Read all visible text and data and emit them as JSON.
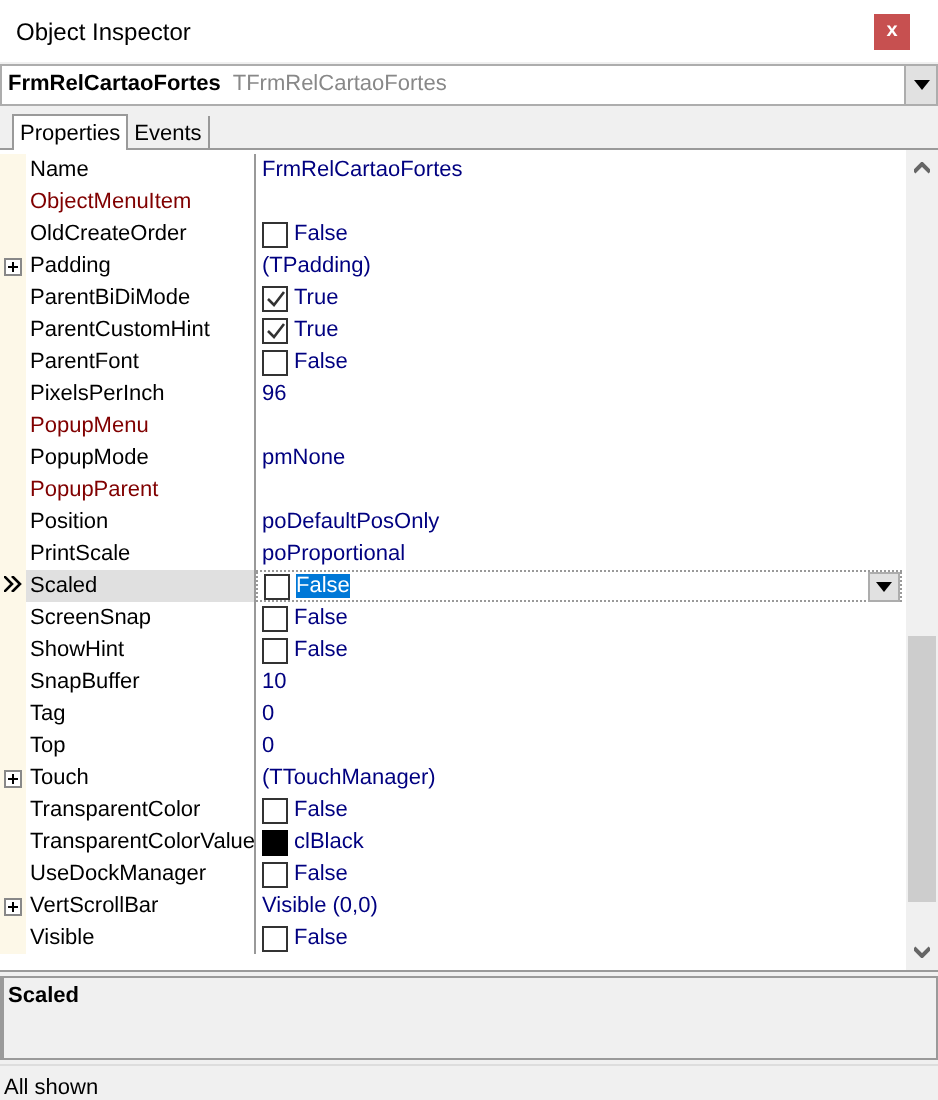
{
  "window": {
    "title": "Object Inspector",
    "close": "x"
  },
  "object_selector": {
    "name": "FrmRelCartaoFortes",
    "type": "TFrmRelCartaoFortes"
  },
  "tabs": [
    {
      "label": "Properties",
      "selected": true
    },
    {
      "label": "Events",
      "selected": false
    }
  ],
  "properties": [
    {
      "name": "Name",
      "kind": "text",
      "value": "FrmRelCartaoFortes",
      "expandable": false,
      "reference": false,
      "selected": false
    },
    {
      "name": "ObjectMenuItem",
      "kind": "text",
      "expandable": false,
      "reference": true,
      "selected": false
    },
    {
      "name": "OldCreateOrder",
      "kind": "checkbox",
      "value": "False",
      "checked": false,
      "expandable": false,
      "reference": false,
      "selected": false
    },
    {
      "name": "Padding",
      "kind": "text",
      "value": "(TPadding)",
      "expandable": true,
      "reference": false,
      "selected": false
    },
    {
      "name": "ParentBiDiMode",
      "kind": "checkbox",
      "value": "True",
      "checked": true,
      "expandable": false,
      "reference": false,
      "selected": false
    },
    {
      "name": "ParentCustomHint",
      "kind": "checkbox",
      "value": "True",
      "checked": true,
      "expandable": false,
      "reference": false,
      "selected": false
    },
    {
      "name": "ParentFont",
      "kind": "checkbox",
      "value": "False",
      "checked": false,
      "expandable": false,
      "reference": false,
      "selected": false
    },
    {
      "name": "PixelsPerInch",
      "kind": "text",
      "value": "96",
      "expandable": false,
      "reference": false,
      "selected": false
    },
    {
      "name": "PopupMenu",
      "kind": "text",
      "expandable": false,
      "reference": true,
      "selected": false
    },
    {
      "name": "PopupMode",
      "kind": "text",
      "value": "pmNone",
      "expandable": false,
      "reference": false,
      "selected": false
    },
    {
      "name": "PopupParent",
      "kind": "text",
      "expandable": false,
      "reference": true,
      "selected": false
    },
    {
      "name": "Position",
      "kind": "text",
      "value": "poDefaultPosOnly",
      "expandable": false,
      "reference": false,
      "selected": false
    },
    {
      "name": "PrintScale",
      "kind": "text",
      "value": "poProportional",
      "expandable": false,
      "reference": false,
      "selected": false
    },
    {
      "name": "Scaled",
      "kind": "checkbox",
      "value": "False",
      "checked": false,
      "expandable": false,
      "reference": false,
      "selected": true
    },
    {
      "name": "ScreenSnap",
      "kind": "checkbox",
      "value": "False",
      "checked": false,
      "expandable": false,
      "reference": false,
      "selected": false
    },
    {
      "name": "ShowHint",
      "kind": "checkbox",
      "value": "False",
      "checked": false,
      "expandable": false,
      "reference": false,
      "selected": false
    },
    {
      "name": "SnapBuffer",
      "kind": "text",
      "value": "10",
      "expandable": false,
      "reference": false,
      "selected": false
    },
    {
      "name": "Tag",
      "kind": "text",
      "value": "0",
      "expandable": false,
      "reference": false,
      "selected": false
    },
    {
      "name": "Top",
      "kind": "text",
      "value": "0",
      "expandable": false,
      "reference": false,
      "selected": false
    },
    {
      "name": "Touch",
      "kind": "text",
      "value": "(TTouchManager)",
      "expandable": true,
      "reference": false,
      "selected": false
    },
    {
      "name": "TransparentColor",
      "kind": "checkbox",
      "value": "False",
      "checked": false,
      "expandable": false,
      "reference": false,
      "selected": false
    },
    {
      "name": "TransparentColorValue",
      "kind": "color",
      "value": "clBlack",
      "color": "#000000",
      "expandable": false,
      "reference": false,
      "selected": false
    },
    {
      "name": "UseDockManager",
      "kind": "checkbox",
      "value": "False",
      "checked": false,
      "expandable": false,
      "reference": false,
      "selected": false
    },
    {
      "name": "VertScrollBar",
      "kind": "text",
      "value": "Visible (0,0)",
      "expandable": true,
      "reference": false,
      "selected": false
    },
    {
      "name": "Visible",
      "kind": "checkbox",
      "value": "False",
      "checked": false,
      "expandable": false,
      "reference": false,
      "selected": false
    }
  ],
  "description": {
    "title": "Scaled"
  },
  "status_bar": {
    "text": "All shown"
  }
}
